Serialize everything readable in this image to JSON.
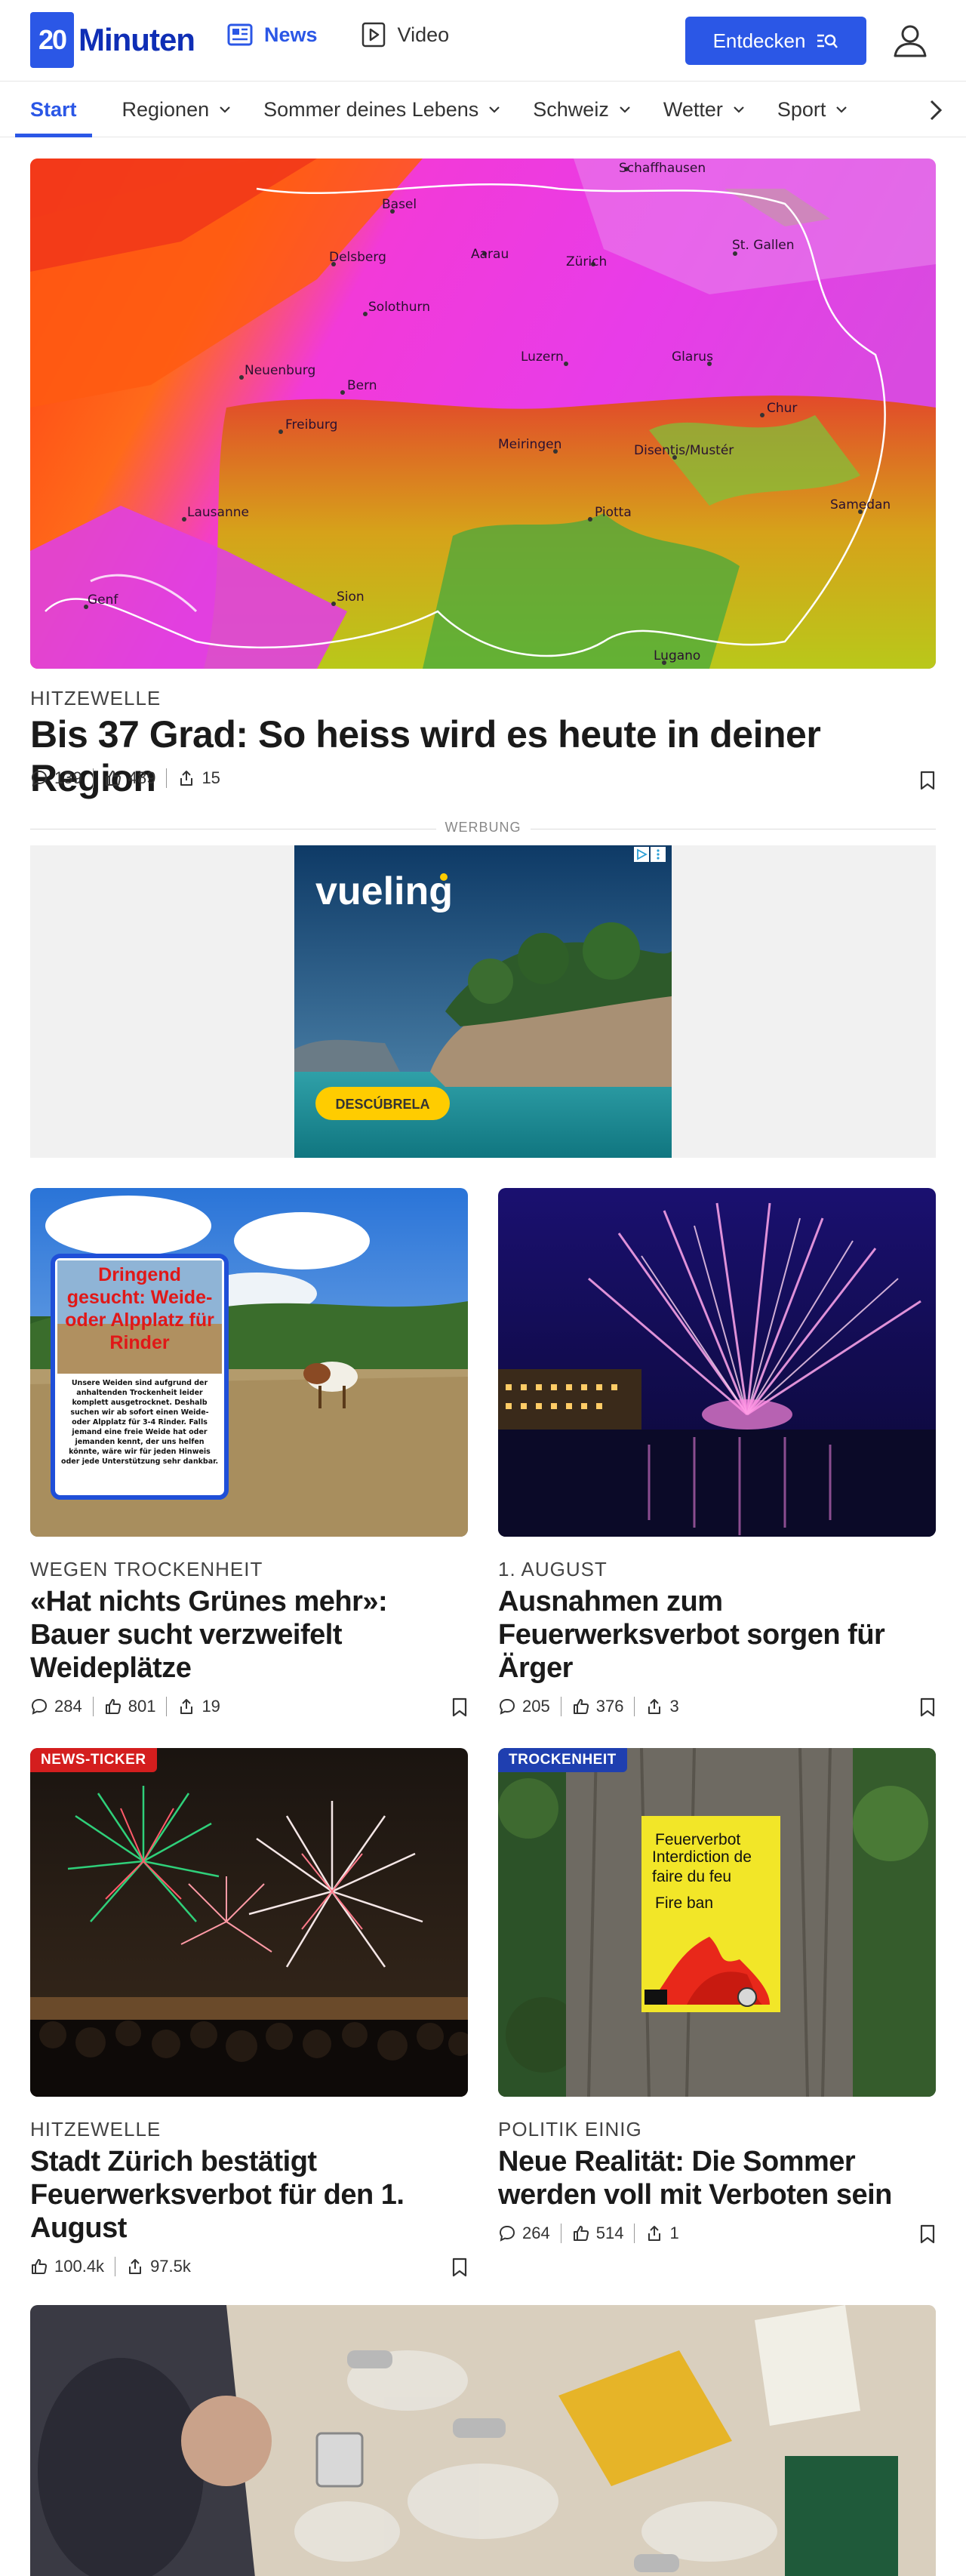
{
  "header": {
    "logo_number": "20",
    "logo_text": "Minuten",
    "nav": [
      {
        "label": "News",
        "icon": "news-icon"
      },
      {
        "label": "Video",
        "icon": "video-play-icon"
      }
    ],
    "discover_label": "Entdecken"
  },
  "subnav": {
    "items": [
      "Start",
      "Regionen",
      "Sommer deines Lebens",
      "Schweiz",
      "Wetter",
      "Sport"
    ]
  },
  "hero": {
    "map_labels": [
      "Schaffhausen",
      "Basel",
      "St. Gallen",
      "Delsberg",
      "Aarau",
      "Zürich",
      "Solothurn",
      "Luzern",
      "Glarus",
      "Neuenburg",
      "Bern",
      "Chur",
      "Freiburg",
      "Meiringen",
      "Disentis/Mustér",
      "Lausanne",
      "Piotta",
      "Samedan",
      "Genf",
      "Sion",
      "Lugano"
    ],
    "kicker": "HITZEWELLE",
    "headline": "Bis 37 Grad: So heiss wird es heute in deiner Region",
    "comments": "139",
    "likes": "489",
    "shares": "15"
  },
  "ad": {
    "label": "WERBUNG",
    "brand": "vueling",
    "cta": "DESCÚBRELA"
  },
  "cards": [
    {
      "kicker": "WEGEN TROCKENHEIT",
      "headline": "«Hat nichts Grünes mehr»: Bauer sucht verzweifelt Weideplätze",
      "comments": "284",
      "likes": "801",
      "shares": "19",
      "poster_title": "Dringend gesucht: Weide- oder Alpplatz für Rinder",
      "poster_text": "Unsere Weiden sind aufgrund der anhaltenden Trockenheit leider komplett ausgetrocknet. Deshalb suchen wir ab sofort einen Weide- oder Alpplatz für 3-4 Rinder. Falls jemand eine freie Weide hat oder jemanden kennt, der uns helfen könnte, wäre wir für jeden Hinweis oder jede Unterstützung sehr dankbar."
    },
    {
      "kicker": "1. AUGUST",
      "headline": "Ausnahmen zum Feuerwerksverbot sorgen für Ärger",
      "comments": "205",
      "likes": "376",
      "shares": "3"
    },
    {
      "badge": "NEWS-TICKER",
      "kicker": "HITZEWELLE",
      "headline": "Stadt Zürich bestätigt Feuerwerksverbot für den 1. August",
      "likes": "100.4k",
      "shares": "97.5k"
    },
    {
      "badge": "TROCKENHEIT",
      "kicker": "POLITIK EINIG",
      "headline": "Neue Realität: Die Sommer werden voll mit Verboten sein",
      "comments": "264",
      "likes": "514",
      "shares": "1",
      "sign_lines": [
        "Feuerverbot",
        "Interdiction de faire du feu",
        "Fire ban"
      ]
    }
  ],
  "colors": {
    "brand_blue": "#2b57e6",
    "logo_blue": "#0f2eb5",
    "ticker_red": "#d41e1e",
    "badge_blue": "#1f3fb0"
  }
}
